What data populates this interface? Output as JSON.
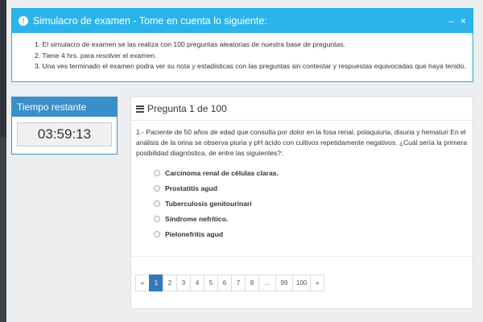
{
  "info": {
    "title": "Simulacro de examen - Tome en cuenta lo siguiente:",
    "items": [
      "1. El simulacro de examen se las realiza con 100 preguntas aleatorias de nuestra base de preguntas.",
      "2. Tiene 4 hrs. para resolver el examen.",
      "3. Una ves terminado el examen podra ver su nota y estadisticas con las preguntas sin contestar y respuestas equivocadas que haya tenido."
    ],
    "minimize_label": "–",
    "close_label": "×"
  },
  "timer": {
    "title": "Tiempo restante",
    "value": "03:59:13"
  },
  "question": {
    "header": "Pregunta 1 de 100",
    "text": "1.- Paciente de 50 años de edad que consulta por dolor en la fosa renal, polaquiuria, disuria y hematuri En el análisis de la orina se observa piuria y pH ácido con cultivos repetidamente negativos. ¿Cuál sería la primera posibilidad diagnóstica, de entre las siguientes?:",
    "options": [
      "Carcinoma renal de células claras.",
      "Prostatitis agud",
      "Tuberculosis genitourinari",
      "Síndrome nefrítico.",
      "Pielonefritis agud"
    ]
  },
  "pagination": {
    "prev": "«",
    "pages": [
      "1",
      "2",
      "3",
      "4",
      "5",
      "6",
      "7",
      "8",
      "...",
      "99",
      "100"
    ],
    "next": "»",
    "active": "1"
  },
  "colors": {
    "info_header": "#2ab4eb",
    "timer_header": "#3a8fc9",
    "active_page": "#337ab7"
  },
  "icons": {
    "info": "exclamation-circle-icon",
    "question": "list-icon"
  }
}
